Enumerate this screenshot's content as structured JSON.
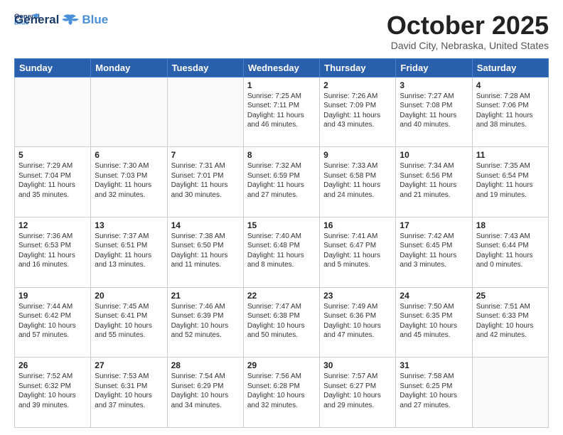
{
  "header": {
    "logo_line1": "General",
    "logo_line2": "Blue",
    "month": "October 2025",
    "location": "David City, Nebraska, United States"
  },
  "days_of_week": [
    "Sunday",
    "Monday",
    "Tuesday",
    "Wednesday",
    "Thursday",
    "Friday",
    "Saturday"
  ],
  "weeks": [
    [
      {
        "day": "",
        "info": ""
      },
      {
        "day": "",
        "info": ""
      },
      {
        "day": "",
        "info": ""
      },
      {
        "day": "1",
        "info": "Sunrise: 7:25 AM\nSunset: 7:11 PM\nDaylight: 11 hours\nand 46 minutes."
      },
      {
        "day": "2",
        "info": "Sunrise: 7:26 AM\nSunset: 7:09 PM\nDaylight: 11 hours\nand 43 minutes."
      },
      {
        "day": "3",
        "info": "Sunrise: 7:27 AM\nSunset: 7:08 PM\nDaylight: 11 hours\nand 40 minutes."
      },
      {
        "day": "4",
        "info": "Sunrise: 7:28 AM\nSunset: 7:06 PM\nDaylight: 11 hours\nand 38 minutes."
      }
    ],
    [
      {
        "day": "5",
        "info": "Sunrise: 7:29 AM\nSunset: 7:04 PM\nDaylight: 11 hours\nand 35 minutes."
      },
      {
        "day": "6",
        "info": "Sunrise: 7:30 AM\nSunset: 7:03 PM\nDaylight: 11 hours\nand 32 minutes."
      },
      {
        "day": "7",
        "info": "Sunrise: 7:31 AM\nSunset: 7:01 PM\nDaylight: 11 hours\nand 30 minutes."
      },
      {
        "day": "8",
        "info": "Sunrise: 7:32 AM\nSunset: 6:59 PM\nDaylight: 11 hours\nand 27 minutes."
      },
      {
        "day": "9",
        "info": "Sunrise: 7:33 AM\nSunset: 6:58 PM\nDaylight: 11 hours\nand 24 minutes."
      },
      {
        "day": "10",
        "info": "Sunrise: 7:34 AM\nSunset: 6:56 PM\nDaylight: 11 hours\nand 21 minutes."
      },
      {
        "day": "11",
        "info": "Sunrise: 7:35 AM\nSunset: 6:54 PM\nDaylight: 11 hours\nand 19 minutes."
      }
    ],
    [
      {
        "day": "12",
        "info": "Sunrise: 7:36 AM\nSunset: 6:53 PM\nDaylight: 11 hours\nand 16 minutes."
      },
      {
        "day": "13",
        "info": "Sunrise: 7:37 AM\nSunset: 6:51 PM\nDaylight: 11 hours\nand 13 minutes."
      },
      {
        "day": "14",
        "info": "Sunrise: 7:38 AM\nSunset: 6:50 PM\nDaylight: 11 hours\nand 11 minutes."
      },
      {
        "day": "15",
        "info": "Sunrise: 7:40 AM\nSunset: 6:48 PM\nDaylight: 11 hours\nand 8 minutes."
      },
      {
        "day": "16",
        "info": "Sunrise: 7:41 AM\nSunset: 6:47 PM\nDaylight: 11 hours\nand 5 minutes."
      },
      {
        "day": "17",
        "info": "Sunrise: 7:42 AM\nSunset: 6:45 PM\nDaylight: 11 hours\nand 3 minutes."
      },
      {
        "day": "18",
        "info": "Sunrise: 7:43 AM\nSunset: 6:44 PM\nDaylight: 11 hours\nand 0 minutes."
      }
    ],
    [
      {
        "day": "19",
        "info": "Sunrise: 7:44 AM\nSunset: 6:42 PM\nDaylight: 10 hours\nand 57 minutes."
      },
      {
        "day": "20",
        "info": "Sunrise: 7:45 AM\nSunset: 6:41 PM\nDaylight: 10 hours\nand 55 minutes."
      },
      {
        "day": "21",
        "info": "Sunrise: 7:46 AM\nSunset: 6:39 PM\nDaylight: 10 hours\nand 52 minutes."
      },
      {
        "day": "22",
        "info": "Sunrise: 7:47 AM\nSunset: 6:38 PM\nDaylight: 10 hours\nand 50 minutes."
      },
      {
        "day": "23",
        "info": "Sunrise: 7:49 AM\nSunset: 6:36 PM\nDaylight: 10 hours\nand 47 minutes."
      },
      {
        "day": "24",
        "info": "Sunrise: 7:50 AM\nSunset: 6:35 PM\nDaylight: 10 hours\nand 45 minutes."
      },
      {
        "day": "25",
        "info": "Sunrise: 7:51 AM\nSunset: 6:33 PM\nDaylight: 10 hours\nand 42 minutes."
      }
    ],
    [
      {
        "day": "26",
        "info": "Sunrise: 7:52 AM\nSunset: 6:32 PM\nDaylight: 10 hours\nand 39 minutes."
      },
      {
        "day": "27",
        "info": "Sunrise: 7:53 AM\nSunset: 6:31 PM\nDaylight: 10 hours\nand 37 minutes."
      },
      {
        "day": "28",
        "info": "Sunrise: 7:54 AM\nSunset: 6:29 PM\nDaylight: 10 hours\nand 34 minutes."
      },
      {
        "day": "29",
        "info": "Sunrise: 7:56 AM\nSunset: 6:28 PM\nDaylight: 10 hours\nand 32 minutes."
      },
      {
        "day": "30",
        "info": "Sunrise: 7:57 AM\nSunset: 6:27 PM\nDaylight: 10 hours\nand 29 minutes."
      },
      {
        "day": "31",
        "info": "Sunrise: 7:58 AM\nSunset: 6:25 PM\nDaylight: 10 hours\nand 27 minutes."
      },
      {
        "day": "",
        "info": ""
      }
    ]
  ]
}
